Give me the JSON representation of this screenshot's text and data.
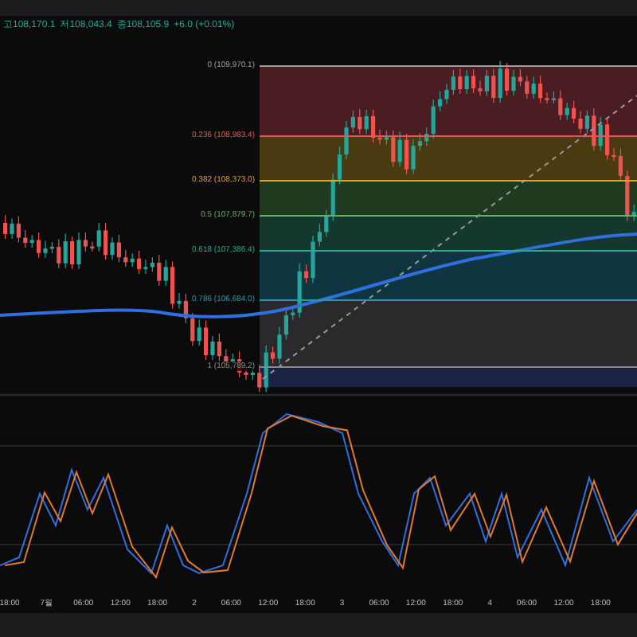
{
  "legend": [
    {
      "text": "고108,170.1"
    },
    {
      "text": "저108,043.4"
    },
    {
      "text": "종108,105.9"
    },
    {
      "text": "+6.0 (+0.01%)"
    }
  ],
  "fibonacci": {
    "levels": [
      {
        "label": "0 (109,970.1)",
        "color": "#9e9e9e"
      },
      {
        "label": "0.236 (108,983.4)",
        "color": "#e05a5a"
      },
      {
        "label": "0.382 (108,373.0)",
        "color": "#e0a030"
      },
      {
        "label": "0.5 (107,879.7)",
        "color": "#5fb35f"
      },
      {
        "label": "0.618 (107,386.4)",
        "color": "#2fa88f"
      },
      {
        "label": "0.786 (106,684.0)",
        "color": "#2b9aa8"
      },
      {
        "label": "1 (105,789.2)",
        "color": "#8a8a8a"
      }
    ]
  },
  "time_axis": {
    "labels": [
      "18:00",
      "7월",
      "06:00",
      "12:00",
      "18:00",
      "2",
      "06:00",
      "12:00",
      "18:00",
      "3",
      "06:00",
      "12:00",
      "18:00",
      "4",
      "06:00",
      "12:00",
      "18:00"
    ]
  }
}
